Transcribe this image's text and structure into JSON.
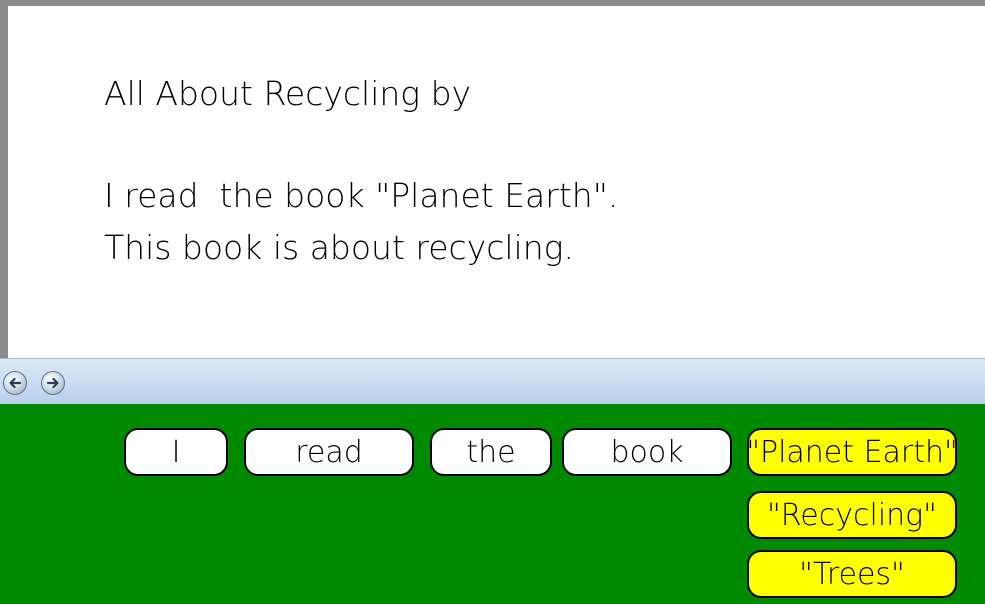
{
  "document": {
    "title": "All About Recycling by",
    "line1": "I read  the book \"Planet Earth\".",
    "line2": "This book is about recycling."
  },
  "navigation": {
    "back_icon": "back-arrow-icon",
    "forward_icon": "forward-arrow-icon"
  },
  "word_bank": {
    "words": [
      "I",
      "read",
      "the",
      "book"
    ],
    "titles": [
      "\"Planet Earth\"",
      "\"Recycling\"",
      "\"Trees\""
    ]
  },
  "colors": {
    "tray_background": "#008a00",
    "word_tile": "#ffffff",
    "title_tile": "#ffff00"
  }
}
